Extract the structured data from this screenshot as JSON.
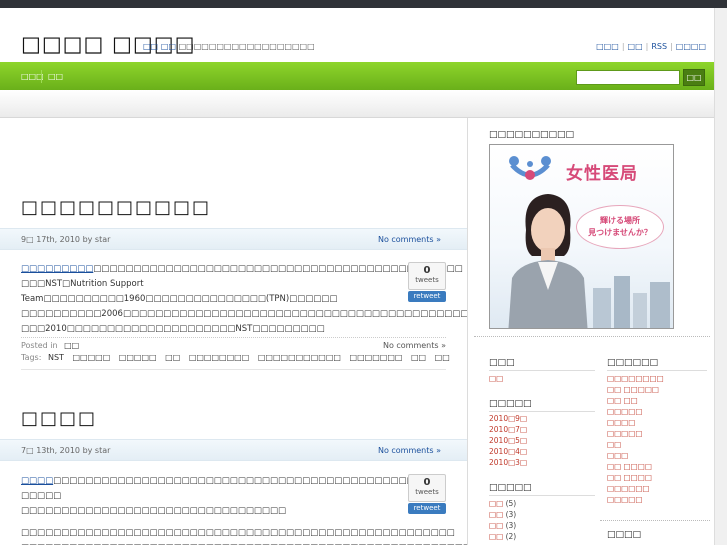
{
  "site": {
    "title": "□□□□ □□□□",
    "desc_highlight": "□□ □□",
    "desc_rest": "□□□□□□□□□□□□□□□□□□",
    "toplinks": [
      "□□□",
      "□□",
      "RSS",
      "□□□□"
    ]
  },
  "nav": {
    "items": [
      "□□□",
      "□□"
    ]
  },
  "search": {
    "placeholder": "",
    "button": "□□"
  },
  "posts": [
    {
      "title": "□□□□□□□□□□",
      "date": "9□ 17th, 2010 by star",
      "comments": "No comments »",
      "body": [
        {
          "link": "□□□□□□□□□",
          "text": "□□□□□□□□□□□□□□□□□□□□□□□□□□□□□□□□□□□□□□□□□□□□□□"
        },
        {
          "text": "□□□NST□Nutrition Support Team□□□□□□□□□□1960□□□□□□□□□□□□□□□(TPN)□□□□□□"
        },
        {
          "text": "□□□□□□□□□□2006□□□□□□□□□□□□□□□□□□□□□□□□□□□□□□□□□□□□□□□□□□□□"
        },
        {
          "text": "□□□2010□□□□□□□□□□□□□□□□□□□□□NST□□□□□□□□□"
        }
      ],
      "tweets": "0",
      "tweets_label": "tweets",
      "retweet": "retweet",
      "posted_in_label": "Posted in",
      "category": "□□",
      "footer_comments": "No comments »",
      "tags_label": "Tags:",
      "tags": [
        "NST",
        "□□□□□",
        "□□□□□",
        "□□",
        "□□□□□□□□",
        "□□□□□□□□□□□",
        "□□□□□□□",
        "□□",
        "□□"
      ]
    },
    {
      "title": "□□□□",
      "date": "7□ 13th, 2010 by star",
      "comments": "No comments »",
      "body": [
        {
          "link": "□□□□",
          "text": "□□□□□□□□□□□□□□□□□□□□□□□□□□□□□□□□□□□□□□□□□□□□□□□ □□□□□"
        },
        {
          "text": "□□□□□□□□□□□□□□□□□□□□□□□□□□□□□□□□□"
        },
        {
          "text": "□□□□□□□□□□□□□□□□□□□□□□□□□□□□□□□□□□□□□□□□□□□□□□□□□□□□□□"
        },
        {
          "text": "□□□□□□□□□□□□□□□□□□□□□□□□□□□□□□□□□□□□□□□□□□□□□□□□□□□□□□□□"
        }
      ],
      "tweets": "0",
      "tweets_label": "tweets",
      "retweet": "retweet"
    }
  ],
  "sidebar": {
    "ad_heading": "□□□□□□□□□□",
    "ad": {
      "brand": "女性医局",
      "bubble_line1": "輝ける場所",
      "bubble_line2": "見つけませんか？"
    },
    "col1": [
      {
        "heading": "□□□",
        "items": [
          {
            "label": "□□",
            "count": ""
          }
        ]
      },
      {
        "heading": "□□□□□",
        "items": [
          {
            "label": "2010□9□",
            "count": ""
          },
          {
            "label": "2010□7□",
            "count": ""
          },
          {
            "label": "2010□5□",
            "count": ""
          },
          {
            "label": "2010□4□",
            "count": ""
          },
          {
            "label": "2010□3□",
            "count": ""
          }
        ]
      },
      {
        "heading": "□□□□□",
        "items": [
          {
            "label": "□□",
            "count": "(5)"
          },
          {
            "label": "□□",
            "count": "(3)"
          },
          {
            "label": "□□",
            "count": "(3)"
          },
          {
            "label": "□□",
            "count": "(2)"
          }
        ]
      }
    ],
    "col2": [
      {
        "heading": "□□□□□□",
        "items": [
          {
            "label": "□□□□□□□□",
            "count": ""
          },
          {
            "label": "□□ □□□□□",
            "count": ""
          },
          {
            "label": "□□ □□",
            "count": ""
          },
          {
            "label": "□□□□□",
            "count": ""
          },
          {
            "label": "□□□□",
            "count": ""
          },
          {
            "label": "□□□□□",
            "count": ""
          },
          {
            "label": "□□",
            "count": ""
          },
          {
            "label": "□□□",
            "count": ""
          },
          {
            "label": "□□ □□□□",
            "count": ""
          },
          {
            "label": "□□ □□□□",
            "count": ""
          },
          {
            "label": "□□□□□□",
            "count": ""
          },
          {
            "label": "□□□□□",
            "count": ""
          }
        ]
      },
      {
        "heading": "□□□□",
        "items": []
      }
    ]
  },
  "colors": {
    "nav_green": "#7cc422",
    "link_blue": "#1a4f9c",
    "sidebar_red": "#c0392b",
    "ad_pink": "#d64a78"
  }
}
